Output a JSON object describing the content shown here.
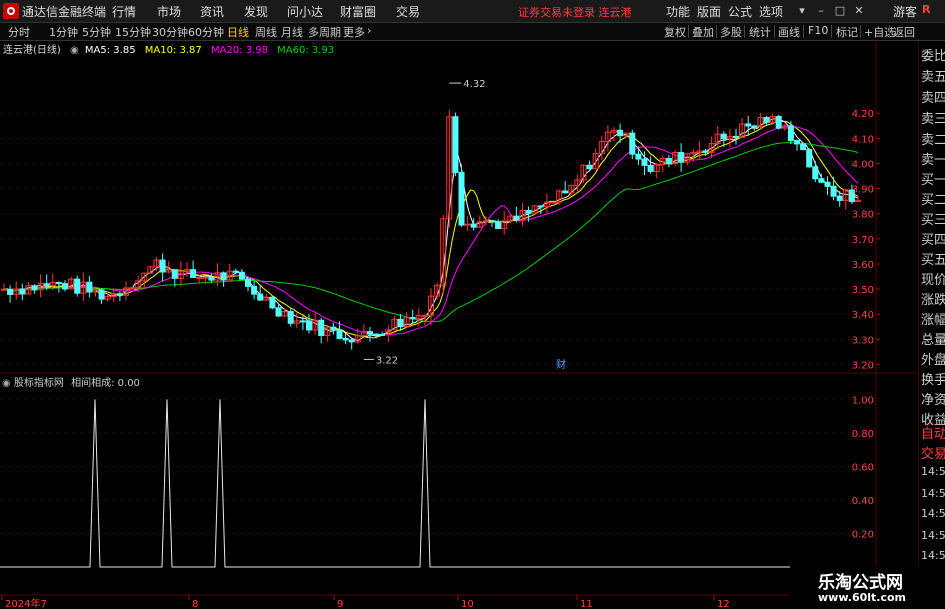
{
  "app": {
    "title": "通达信金融终端",
    "warning": "证券交易未登录 连云港",
    "login": "游客"
  },
  "menu_main": [
    "行情",
    "市场",
    "资讯",
    "发现",
    "问小达",
    "财富圈",
    "交易"
  ],
  "menu_right": [
    "功能",
    "版面",
    "公式",
    "选项"
  ],
  "window_controls": [
    "▾",
    "–",
    "□",
    "✕"
  ],
  "toolbar": {
    "timeframes": [
      "分时",
      "1分钟",
      "5分钟",
      "15分钟",
      "30分钟",
      "60分钟",
      "日线",
      "周线",
      "月线",
      "多周期",
      "更多"
    ],
    "active": "日线",
    "buttons": [
      "复权",
      "叠加",
      "多股",
      "统计",
      "画线",
      "F10",
      "标记",
      "+自选",
      "返回"
    ]
  },
  "chart_header": {
    "stock": "连云港(日线)",
    "ma5": "MA5: 3.85",
    "ma10": "MA10: 3.87",
    "ma20": "MA20: 3.98",
    "ma60": "MA60: 3.93"
  },
  "colors": {
    "up": "#ff3232",
    "down": "#54ffff",
    "ma5": "#ffffff",
    "ma10": "#ffff00",
    "ma20": "#ff00ff",
    "ma60": "#00cc00",
    "grid": "#550000"
  },
  "annotations": {
    "high": "4.32",
    "low": "3.22",
    "event": "财"
  },
  "indicator_header": {
    "name": "股标指标网",
    "series": "相间相成: 0.00"
  },
  "watermark": {
    "title": "乐淘公式网",
    "url": "www.60lt.com"
  },
  "sidebar_labels": [
    "R",
    "委比",
    "卖五",
    "卖四",
    "卖三",
    "卖二",
    "卖一",
    "买一",
    "买二",
    "买三",
    "买四",
    "买五",
    "现价",
    "涨跌",
    "涨幅",
    "总量",
    "外盘",
    "换手",
    "净资",
    "收益",
    "自动",
    "交易",
    "14:56",
    "14:56",
    "14:56",
    "14:56",
    "14:56",
    "14:56",
    "14:56"
  ],
  "chart_data": [
    {
      "type": "candlestick",
      "title": "连云港(日线)",
      "x": [
        "2024年7",
        "8",
        "9",
        "10",
        "11",
        "12"
      ],
      "ylim": [
        3.17,
        4.4
      ],
      "yticks": [
        4.2,
        4.1,
        4.0,
        3.9,
        3.8,
        3.7,
        3.6,
        3.5,
        3.4,
        3.3,
        3.2
      ],
      "series": [
        {
          "name": "MA5",
          "value": 3.85
        },
        {
          "name": "MA10",
          "value": 3.87
        },
        {
          "name": "MA20",
          "value": 3.98
        },
        {
          "name": "MA60",
          "value": 3.93
        }
      ],
      "max_label": 4.32,
      "min_label": 3.22
    },
    {
      "type": "line",
      "title": "股标指标网",
      "series": [
        {
          "name": "相间相成",
          "value": 0.0
        }
      ],
      "ylim": [
        0,
        1.05
      ],
      "yticks": [
        1.0,
        0.8,
        0.6,
        0.4,
        0.2
      ]
    }
  ]
}
